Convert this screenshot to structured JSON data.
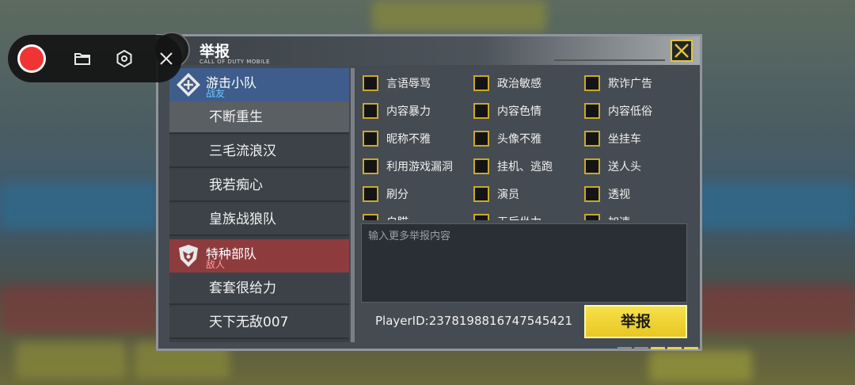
{
  "recorder": {
    "record_icon": "record-icon",
    "folder_icon": "folder-icon",
    "settings_icon": "settings-icon",
    "close_icon": "close-icon"
  },
  "dialog": {
    "title": "举报",
    "logo_caption": "CALL OF DUTY MOBILE",
    "close_icon": "close-x-icon",
    "accent_color": "#e3c43a"
  },
  "teams": [
    {
      "name": "游击小队",
      "role": "战友",
      "color": "#3e5d8c",
      "players": [
        "不断重生",
        "三毛流浪汉",
        "我若痴心",
        "皇族战狼队"
      ]
    },
    {
      "name": "特种部队",
      "role": "敌人",
      "color": "#8e3b3e",
      "players": [
        "套套很给力",
        "天下无敌007"
      ]
    }
  ],
  "selected_player": "不断重生",
  "reasons": [
    [
      "言语辱骂",
      "政治敏感",
      "欺诈广告"
    ],
    [
      "内容暴力",
      "内容色情",
      "内容低俗"
    ],
    [
      "昵称不雅",
      "头像不雅",
      "坐挂车"
    ],
    [
      "利用游戏漏洞",
      "挂机、逃跑",
      "送人头"
    ],
    [
      "刷分",
      "演员",
      "透视"
    ],
    [
      "自瞄",
      "无后坐力",
      "加速"
    ]
  ],
  "textarea": {
    "placeholder": "输入更多举报内容"
  },
  "player_id": "PlayerID:2378198816747545421",
  "report_button": "举报"
}
